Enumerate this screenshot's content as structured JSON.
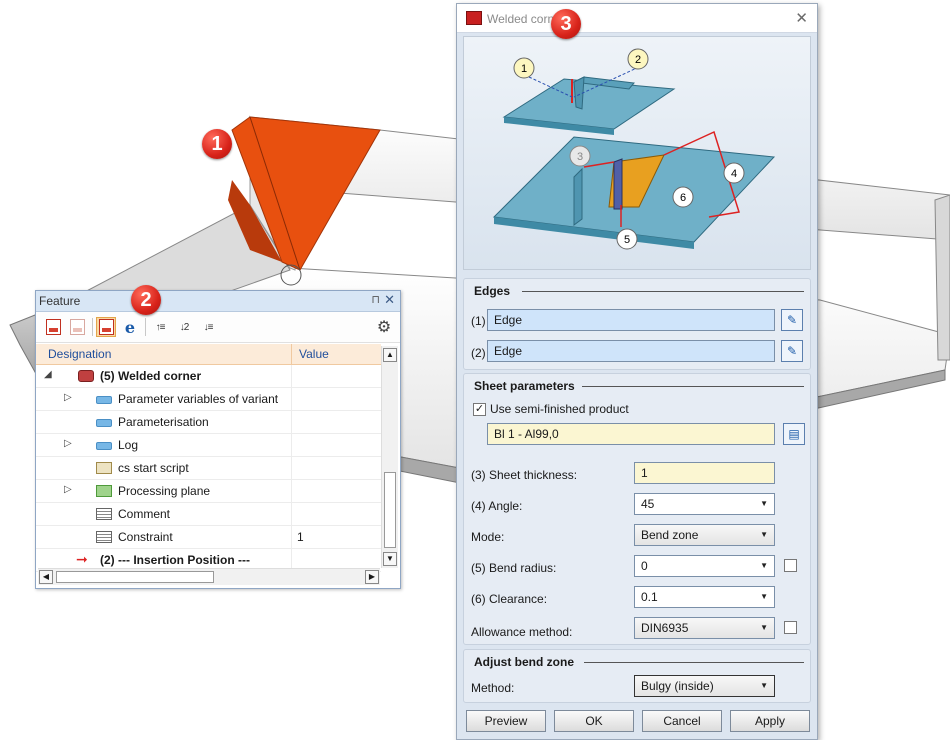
{
  "badges": [
    "1",
    "2",
    "3"
  ],
  "feature_panel": {
    "title": "Feature",
    "pin_icon": "pin-icon",
    "close_icon": "close-icon",
    "columns": {
      "designation": "Designation",
      "value": "Value"
    },
    "rows": [
      {
        "label": "(5) Welded corner",
        "value": ""
      },
      {
        "label": "Parameter variables of variant",
        "value": ""
      },
      {
        "label": "Parameterisation",
        "value": ""
      },
      {
        "label": "Log",
        "value": ""
      },
      {
        "label": "cs start script",
        "value": ""
      },
      {
        "label": "Processing plane",
        "value": ""
      },
      {
        "label": "Comment",
        "value": ""
      },
      {
        "label": "Constraint",
        "value": "1"
      },
      {
        "label": "(2) --- Insertion Position ---",
        "value": ""
      }
    ]
  },
  "dialog": {
    "title": "Welded corner",
    "diagram_labels": [
      "1",
      "2",
      "3",
      "4",
      "5",
      "6"
    ],
    "edges": {
      "title": "Edges",
      "edge1_label": "(1)",
      "edge1_value": "Edge",
      "edge2_label": "(2)",
      "edge2_value": "Edge"
    },
    "sheet": {
      "title": "Sheet parameters",
      "use_semi_label": "Use semi-finished product",
      "use_semi_checked": "✓",
      "semi_value": "Bl 1 - Al99,0",
      "thickness_label": "(3) Sheet thickness:",
      "thickness_value": "1",
      "angle_label": "(4) Angle:",
      "angle_value": "45",
      "mode_label": "Mode:",
      "mode_value": "Bend zone",
      "radius_label": "(5) Bend radius:",
      "radius_value": "0",
      "clearance_label": "(6) Clearance:",
      "clearance_value": "0.1",
      "allowance_label": "Allowance method:",
      "allowance_value": "DIN6935"
    },
    "bend": {
      "title": "Adjust bend zone",
      "method_label": "Method:",
      "method_value": "Bulgy (inside)"
    },
    "buttons": {
      "preview": "Preview",
      "ok": "OK",
      "cancel": "Cancel",
      "apply": "Apply"
    }
  },
  "colors": {
    "weld": "#e8500f",
    "sheet": "#f2f2f2",
    "diagram_sheet": "#6fb0c8",
    "badge": "#d8231a"
  }
}
